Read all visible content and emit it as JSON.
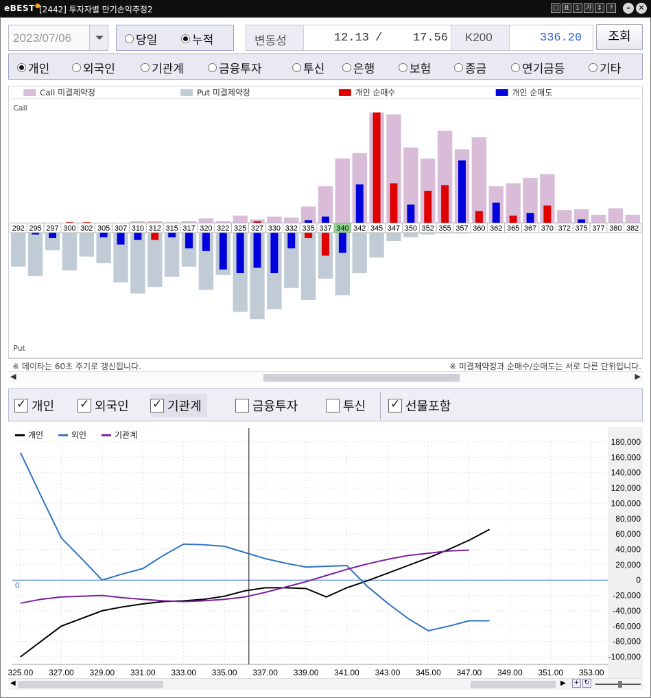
{
  "window": {
    "logo_text": "eBEST",
    "title": "[2442] 투자자별 만기손익추정2",
    "title_buttons": [
      "□",
      "표",
      "1",
      "가",
      "↕",
      "?"
    ],
    "min_glyph": "–",
    "close_glyph": "✕"
  },
  "controls": {
    "date": "2023/07/06",
    "mode_options": [
      {
        "label": "당일",
        "selected": false
      },
      {
        "label": "누적",
        "selected": true
      }
    ],
    "volatility_label": "변동성",
    "volatility_1": "12.13",
    "volatility_sep": "/",
    "volatility_2": "17.56",
    "k200_label": "K200",
    "k200_value": "336.20",
    "query_button": "조회"
  },
  "investors": [
    {
      "label": "개인",
      "selected": true
    },
    {
      "label": "외국인",
      "selected": false
    },
    {
      "label": "기관계",
      "selected": false
    },
    {
      "label": "금융투자",
      "selected": false
    },
    {
      "label": "투신",
      "selected": false
    },
    {
      "label": "은행",
      "selected": false
    },
    {
      "label": "보험",
      "selected": false
    },
    {
      "label": "종금",
      "selected": false
    },
    {
      "label": "연기금등",
      "selected": false
    },
    {
      "label": "기타",
      "selected": false
    }
  ],
  "option_chart": {
    "legend": [
      {
        "label": "Call 미결제약정",
        "color": "#d8bcd8"
      },
      {
        "label": "Put 미결제약정",
        "color": "#c0cbd6"
      },
      {
        "label": "개인 순매수",
        "color": "#e00000"
      },
      {
        "label": "개인 순매도",
        "color": "#0000dd"
      }
    ],
    "call_label": "Call",
    "put_label": "Put",
    "highlight_strike": "340",
    "footnote_left": "※ 데이타는 60초 주기로 갱신됩니다.",
    "footnote_right": "※ 미결제약정과 순매수/순매도는 서로 다른 단위입니다."
  },
  "chart_data": [
    {
      "type": "bar",
      "title": "",
      "categories": [
        "292",
        "295",
        "297",
        "300",
        "302",
        "305",
        "307",
        "310",
        "312",
        "315",
        "317",
        "320",
        "322",
        "325",
        "327",
        "330",
        "332",
        "335",
        "337",
        "340",
        "342",
        "345",
        "347",
        "350",
        "352",
        "355",
        "357",
        "360",
        "362",
        "365",
        "367",
        "370",
        "372",
        "375",
        "377",
        "380",
        "382"
      ],
      "series": [
        {
          "name": "Call 미결제약정",
          "values": [
            0,
            0,
            0,
            0,
            0,
            0,
            0,
            2,
            2,
            1,
            2,
            5,
            2,
            8,
            4,
            7,
            6,
            18,
            40,
            70,
            76,
            120,
            118,
            82,
            70,
            100,
            80,
            93,
            40,
            43,
            49,
            53,
            14,
            15,
            9,
            16,
            9
          ]
        },
        {
          "name": "Put 미결제약정",
          "values": [
            -37,
            -47,
            -19,
            -41,
            -26,
            -33,
            -54,
            -66,
            -59,
            -48,
            -37,
            -62,
            -46,
            -86,
            -94,
            -83,
            -60,
            -73,
            -50,
            -68,
            -44,
            -27,
            -9,
            -5,
            -2,
            -1,
            -1,
            0,
            0,
            0,
            0,
            0,
            0,
            0,
            0,
            0,
            0
          ]
        },
        {
          "name": "개인 순매수",
          "values": [
            0,
            0,
            0,
            1,
            1,
            0,
            0,
            0,
            -8,
            0,
            0,
            0,
            0,
            0,
            2,
            0,
            0,
            -6,
            -25,
            0,
            0,
            120,
            43,
            0,
            35,
            41,
            0,
            13,
            0,
            8,
            0,
            19,
            0,
            0,
            0,
            0,
            0
          ]
        },
        {
          "name": "개인 순매도",
          "values": [
            0,
            -2,
            -6,
            0,
            0,
            -5,
            -13,
            -8,
            0,
            -5,
            -17,
            -20,
            -40,
            -44,
            -38,
            -44,
            -17,
            3,
            7,
            -22,
            42,
            0,
            0,
            20,
            0,
            0,
            68,
            0,
            22,
            0,
            11,
            0,
            0,
            4,
            0,
            0,
            0
          ]
        }
      ]
    },
    {
      "type": "line",
      "x": [
        325,
        326,
        327,
        328,
        329,
        330,
        331,
        332,
        333,
        334,
        335,
        336,
        337,
        338,
        339,
        340,
        341,
        342,
        343,
        344,
        345,
        346,
        347,
        348,
        349,
        350,
        351,
        352,
        353
      ],
      "ylim": [
        -100000,
        180000
      ],
      "yticks": [
        "180,000",
        "160,000",
        "140,000",
        "120,000",
        "100,000",
        "80,000",
        "60,000",
        "40,000",
        "20,000",
        "0",
        "-20,000",
        "-40,000",
        "-60,000",
        "-80,000",
        "-100,000"
      ],
      "xticks": [
        "325.00",
        "327.00",
        "329.00",
        "331.00",
        "333.00",
        "335.00",
        "337.00",
        "339.00",
        "341.00",
        "343.00",
        "345.00",
        "347.00",
        "349.00",
        "351.00",
        "353.00"
      ],
      "zero_label": "0",
      "series": [
        {
          "name": "개인",
          "color": "#000000",
          "values": [
            -100000,
            -80000,
            -60000,
            -50000,
            -40000,
            -35000,
            -31000,
            -28000,
            -27000,
            -25000,
            -21000,
            -14000,
            -10000,
            -10000,
            -11000,
            -22000,
            -10000,
            -1000,
            9000,
            19000,
            29000,
            40000,
            52000,
            66000,
            null,
            null,
            null,
            null,
            null
          ]
        },
        {
          "name": "외인",
          "color": "#2f74c0",
          "values": [
            166000,
            110000,
            55000,
            28000,
            0,
            8000,
            15000,
            32000,
            47000,
            46000,
            44000,
            36000,
            28000,
            22000,
            17000,
            18000,
            19000,
            -8000,
            -30000,
            -50000,
            -66000,
            -60000,
            -53000,
            -53000,
            null,
            null,
            null,
            null,
            null
          ]
        },
        {
          "name": "기관계",
          "color": "#7b1e9e",
          "values": [
            -30000,
            -25000,
            -22000,
            -21000,
            -20000,
            -23000,
            -25000,
            -27000,
            -28000,
            -27000,
            -25000,
            -22000,
            -16000,
            -9000,
            -2000,
            6000,
            14000,
            21000,
            27000,
            32000,
            35000,
            38000,
            39000,
            null,
            null,
            null,
            null,
            null,
            null
          ]
        }
      ]
    }
  ],
  "checks": [
    {
      "label": "개인",
      "checked": true
    },
    {
      "label": "외국인",
      "checked": true
    },
    {
      "label": "기관계",
      "checked": true
    },
    {
      "label": "금융투자",
      "checked": false
    },
    {
      "label": "투신",
      "checked": false
    },
    {
      "label": "선물포함",
      "checked": true
    }
  ]
}
